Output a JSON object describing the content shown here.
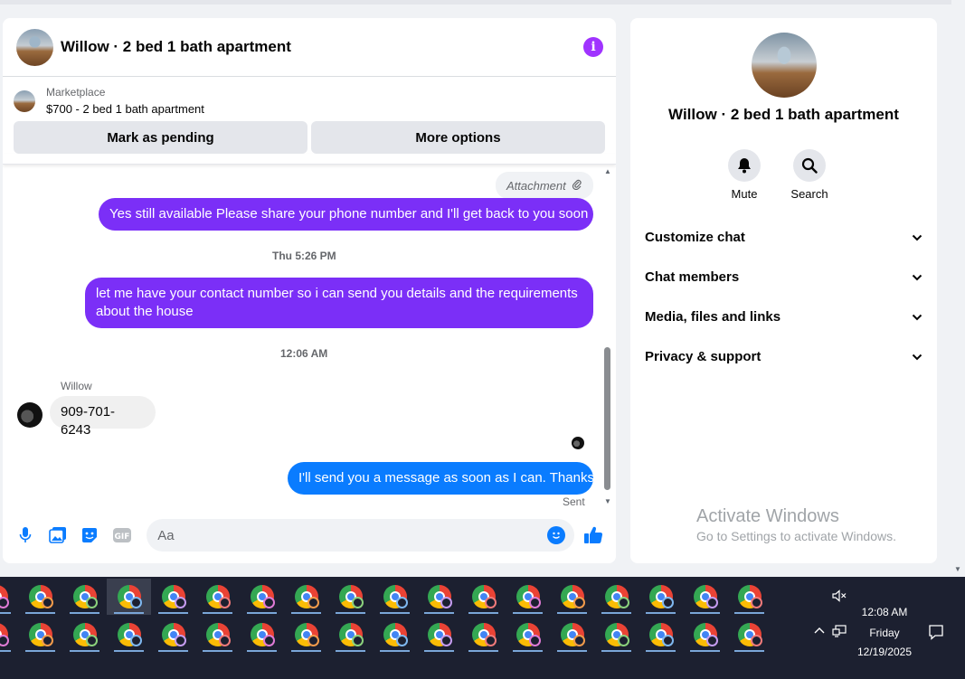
{
  "chat": {
    "title": "Willow · 2 bed 1 bath apartment",
    "info_icon": "info-icon",
    "marketplace_label": "Marketplace",
    "listing": "$700 - 2 bed 1 bath apartment",
    "mark_pending_label": "Mark as pending",
    "more_options_label": "More options",
    "attachment_label": "Attachment",
    "messages": [
      {
        "text": "Yes still available Please share your phone number and I'll get back to you soon"
      },
      {
        "text": "let me have your contact number so i can send you details and the requirements about the house"
      },
      {
        "text": "909-701-6243"
      },
      {
        "text": "I'll send you a message as soon as I can. Thanks"
      }
    ],
    "timestamps": [
      "Thu 5:26 PM",
      "12:06 AM"
    ],
    "sender_name": "Willow",
    "sent_status": "Sent",
    "input_placeholder": "Aa",
    "input_value": ""
  },
  "side": {
    "title": "Willow · 2 bed 1 bath apartment",
    "actions": [
      {
        "label": "Mute",
        "icon": "bell-icon"
      },
      {
        "label": "Search",
        "icon": "search-icon"
      }
    ],
    "sections": [
      {
        "label": "Customize chat"
      },
      {
        "label": "Chat members"
      },
      {
        "label": "Media, files and links"
      },
      {
        "label": "Privacy & support"
      }
    ]
  },
  "watermark": {
    "line1": "Activate Windows",
    "line2": "Go to Settings to activate Windows."
  },
  "taskbar": {
    "time": "12:08 AM",
    "day": "Friday",
    "date": "12/19/2025"
  },
  "colors": {
    "purple_bubble": "#7b2ff7",
    "blue_bubble": "#0a7cff",
    "info_purple": "#a033ff"
  }
}
